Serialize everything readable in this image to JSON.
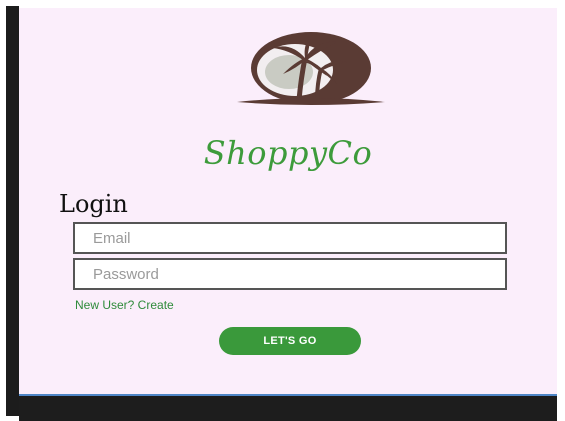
{
  "app": {
    "brand_name": "ShoppyCo",
    "logo_icon": "palm-tree-logo-icon"
  },
  "login": {
    "title": "Login",
    "email_placeholder": "Email",
    "password_placeholder": "Password",
    "new_user_link": "New User? Create",
    "submit_label": "LET'S GO"
  },
  "colors": {
    "screen_background": "#fbeefb",
    "brand_green": "#3d9b3b",
    "button_green": "#3a993b",
    "logo_brown": "#5a3b34"
  }
}
